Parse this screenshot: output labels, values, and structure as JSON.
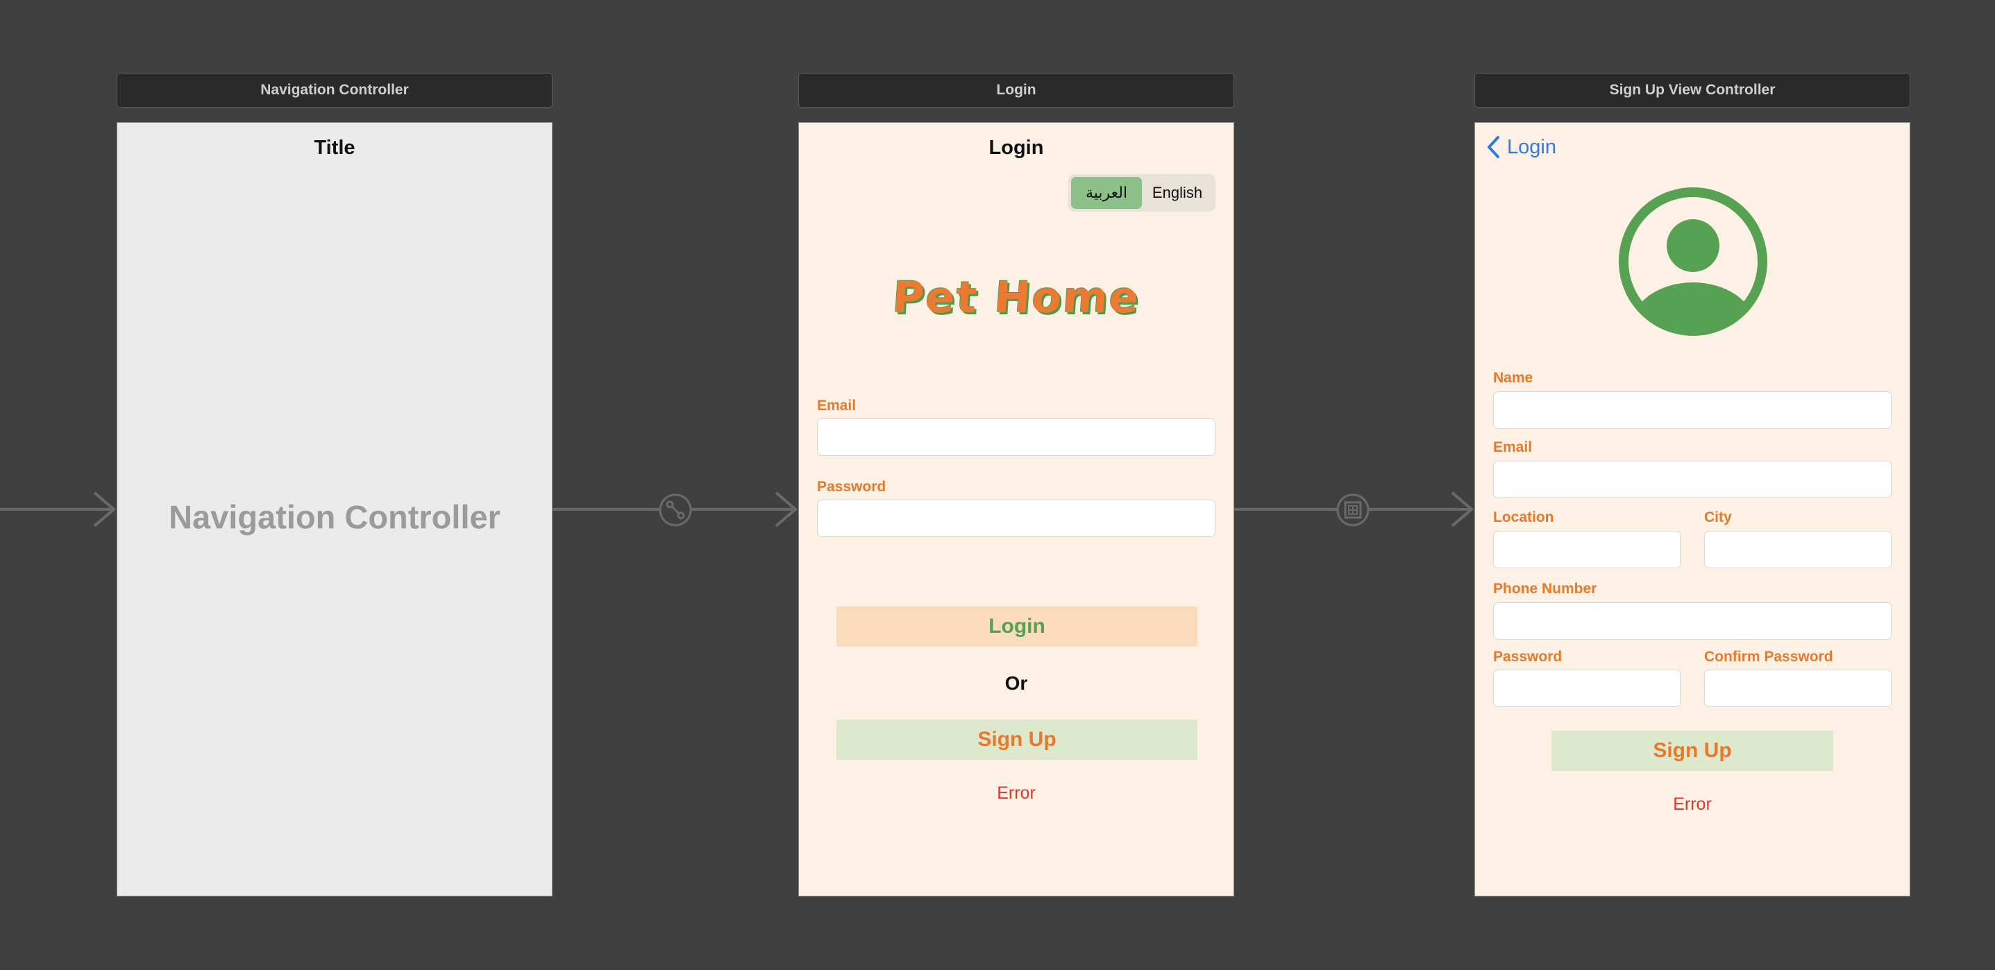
{
  "scenes": {
    "navigation": {
      "header": "Navigation Controller",
      "nav_title": "Title",
      "placeholder": "Navigation Controller"
    },
    "login": {
      "header": "Login",
      "nav_title": "Login",
      "language_segments": [
        "العربية",
        "English"
      ],
      "selected_segment": 0,
      "logo_text": "Pet Home",
      "email_label": "Email",
      "password_label": "Password",
      "login_button": "Login",
      "or_label": "Or",
      "signup_button": "Sign Up",
      "error_label": "Error"
    },
    "signup": {
      "header": "Sign Up View Controller",
      "back_label": "Login",
      "name_label": "Name",
      "email_label": "Email",
      "location_label": "Location",
      "city_label": "City",
      "phone_label": "Phone Number",
      "password_label": "Password",
      "confirm_password_label": "Confirm Password",
      "signup_button": "Sign Up",
      "error_label": "Error"
    }
  },
  "colors": {
    "canvas": "#404040",
    "screen_bg": "#fcf1e4",
    "accent_orange": "#e8792c",
    "accent_green": "#56a152",
    "link_blue": "#2f7be0",
    "error_red": "#d9382e"
  },
  "icons": [
    "chevron-left-icon",
    "user-avatar-icon",
    "segue-show-icon",
    "segue-present-icon",
    "arrow-right-icon"
  ]
}
